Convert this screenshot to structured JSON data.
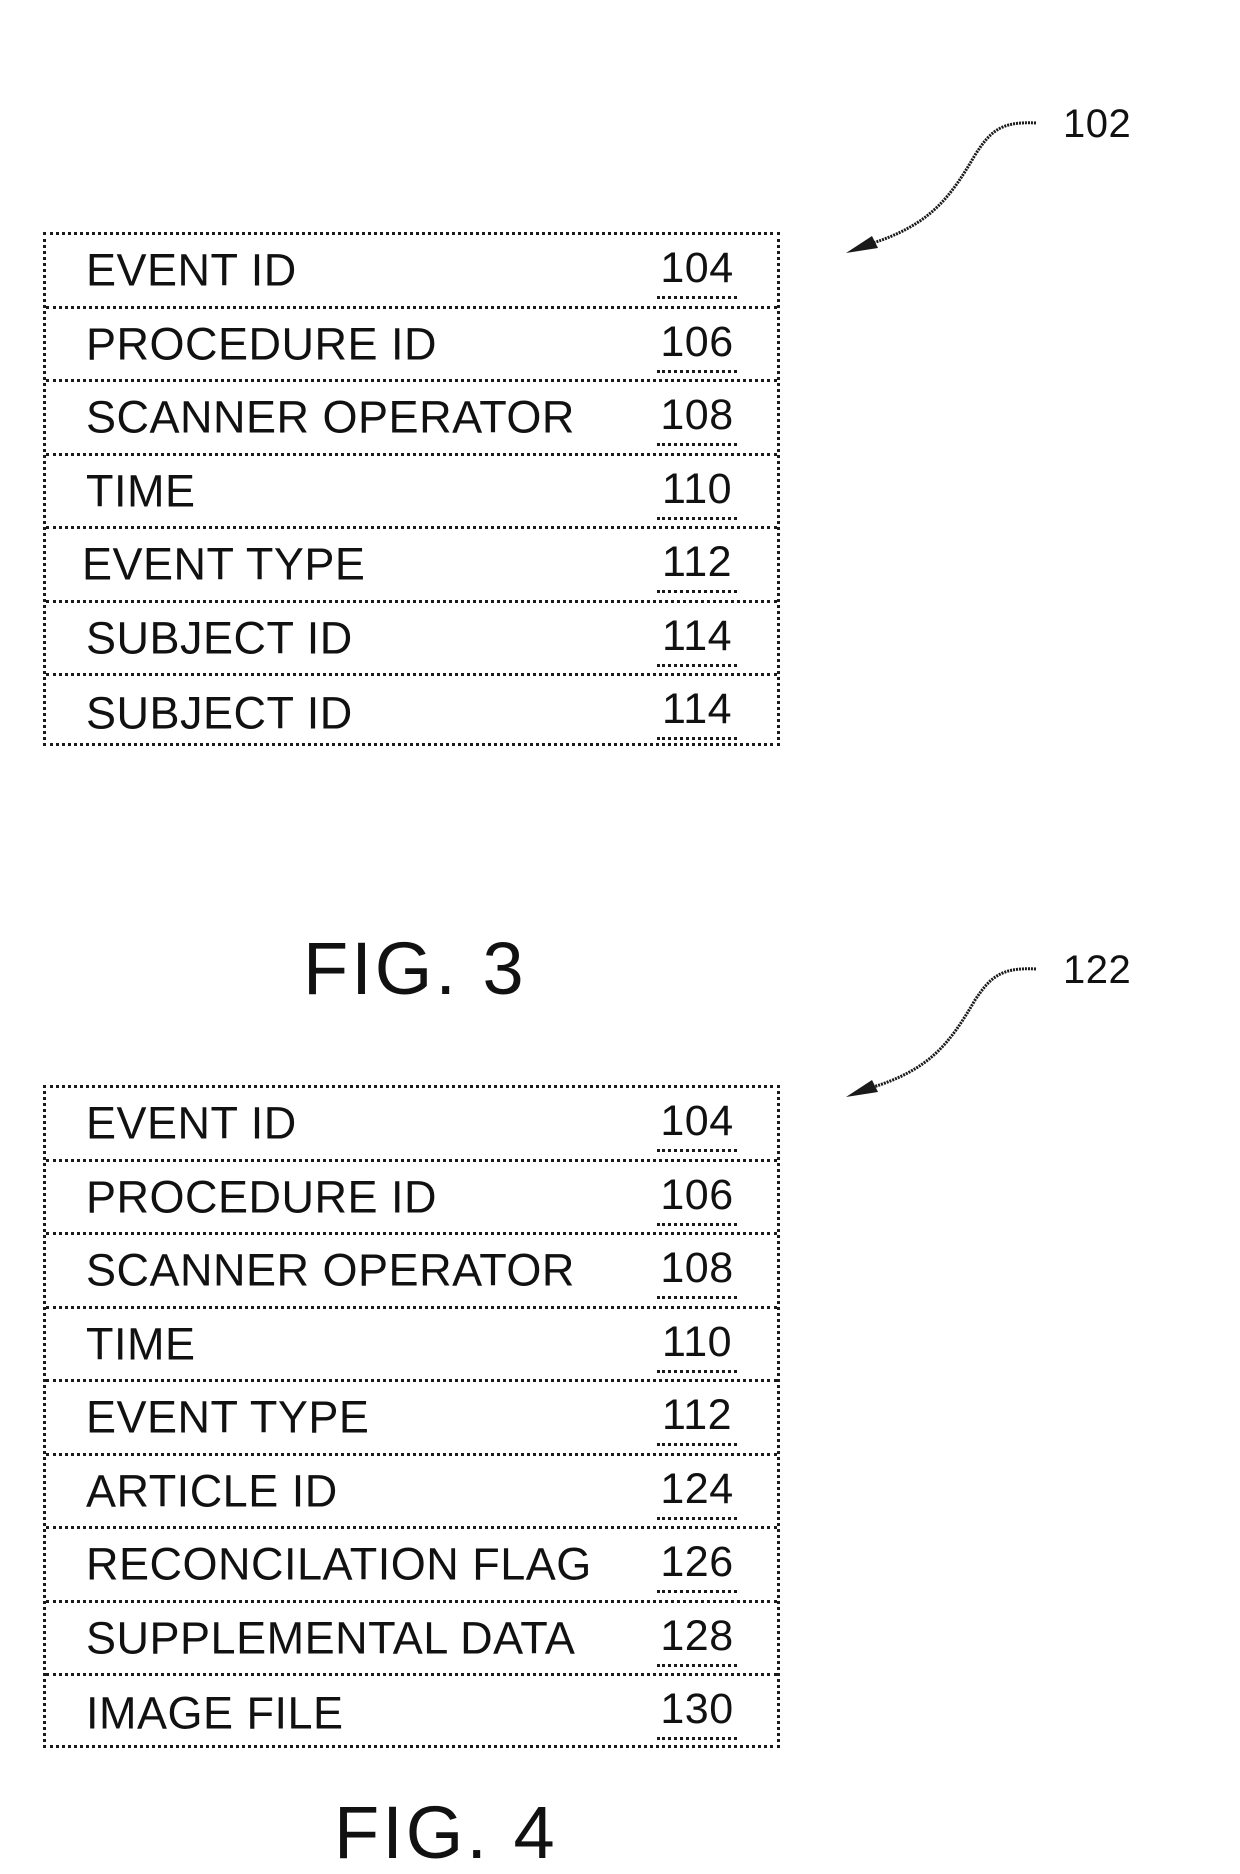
{
  "figures": [
    {
      "caption": "FIG. 3",
      "callout": "102",
      "rows": [
        {
          "label": "EVENT ID",
          "ref": "104"
        },
        {
          "label": "PROCEDURE ID",
          "ref": "106"
        },
        {
          "label": "SCANNER OPERATOR",
          "ref": "108"
        },
        {
          "label": "TIME",
          "ref": "110"
        },
        {
          "label": "EVENT TYPE",
          "ref": "112"
        },
        {
          "label": "SUBJECT ID",
          "ref": "114"
        },
        {
          "label": "SUBJECT ID",
          "ref": "114"
        }
      ]
    },
    {
      "caption": "FIG. 4",
      "callout": "122",
      "rows": [
        {
          "label": "EVENT ID",
          "ref": "104"
        },
        {
          "label": "PROCEDURE ID",
          "ref": "106"
        },
        {
          "label": "SCANNER OPERATOR",
          "ref": "108"
        },
        {
          "label": "TIME",
          "ref": "110"
        },
        {
          "label": "EVENT TYPE",
          "ref": "112"
        },
        {
          "label": "ARTICLE ID",
          "ref": "124"
        },
        {
          "label": "RECONCILATION FLAG",
          "ref": "126"
        },
        {
          "label": "SUPPLEMENTAL DATA",
          "ref": "128"
        },
        {
          "label": "IMAGE FILE",
          "ref": "130"
        }
      ]
    }
  ]
}
